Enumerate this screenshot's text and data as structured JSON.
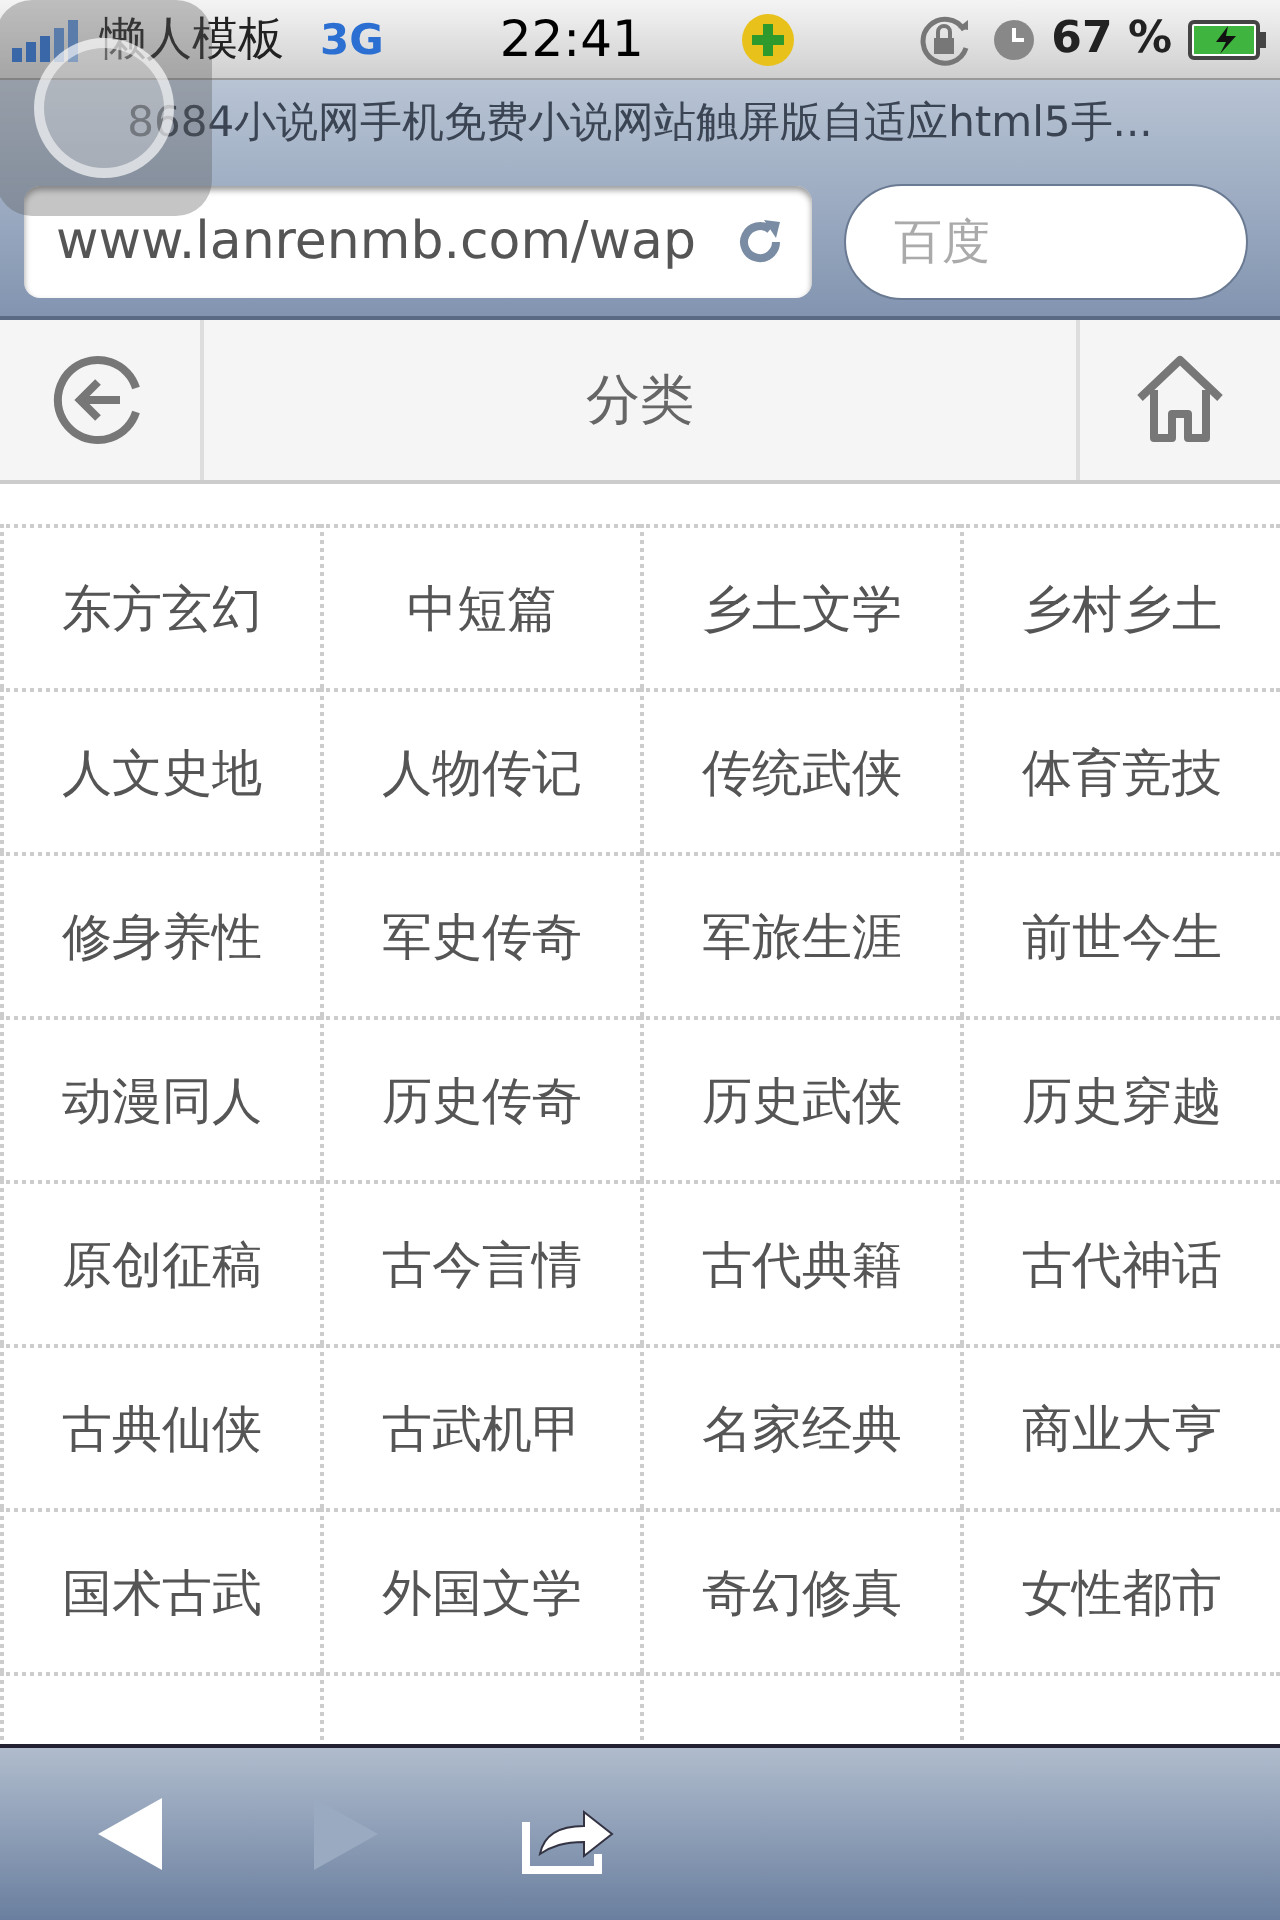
{
  "status_bar": {
    "carrier": "懒人模板",
    "network": "3G",
    "time": "22:41",
    "battery": "67 %"
  },
  "browser": {
    "page_title": "8684小说网手机免费小说网站触屏版自适应html5手...",
    "url": "www.lanrenmb.com/wap",
    "search": {
      "placeholder": "百度"
    }
  },
  "header": {
    "title": "分类"
  },
  "categories": [
    {
      "label": "东方玄幻"
    },
    {
      "label": "中短篇"
    },
    {
      "label": "乡土文学"
    },
    {
      "label": "乡村乡土"
    },
    {
      "label": "人文史地"
    },
    {
      "label": "人物传记"
    },
    {
      "label": "传统武侠"
    },
    {
      "label": "体育竞技"
    },
    {
      "label": "修身养性"
    },
    {
      "label": "军史传奇"
    },
    {
      "label": "军旅生涯"
    },
    {
      "label": "前世今生"
    },
    {
      "label": "动漫同人"
    },
    {
      "label": "历史传奇"
    },
    {
      "label": "历史武侠"
    },
    {
      "label": "历史穿越"
    },
    {
      "label": "原创征稿"
    },
    {
      "label": "古今言情"
    },
    {
      "label": "古代典籍"
    },
    {
      "label": "古代神话"
    },
    {
      "label": "古典仙侠"
    },
    {
      "label": "古武机甲"
    },
    {
      "label": "名家经典"
    },
    {
      "label": "商业大亨"
    },
    {
      "label": "国术古武"
    },
    {
      "label": "外国文学"
    },
    {
      "label": "奇幻修真"
    },
    {
      "label": "女性都市"
    }
  ],
  "toolbar": [
    {
      "kind": "back",
      "disabled": false
    },
    {
      "kind": "forward",
      "disabled": true
    },
    {
      "kind": "share",
      "disabled": false
    }
  ]
}
